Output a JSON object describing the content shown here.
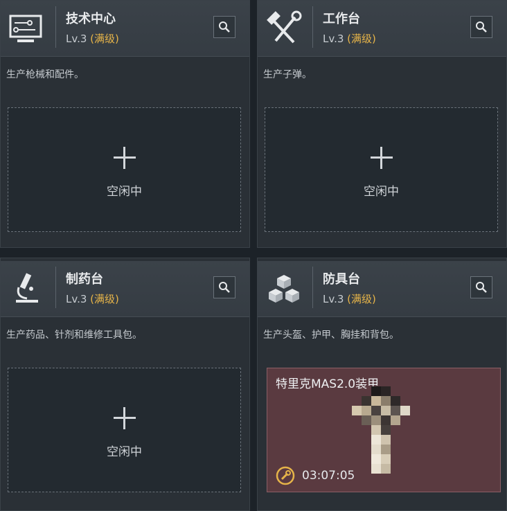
{
  "cards": [
    {
      "title": "技术中心",
      "level_prefix": "Lv.3",
      "level_status": "(满级)",
      "description": "生产枪械和配件。",
      "slot_text": "空闲中",
      "icon": "computer-terminal-icon"
    },
    {
      "title": "工作台",
      "level_prefix": "Lv.3",
      "level_status": "(满级)",
      "description": "生产子弹。",
      "slot_text": "空闲中",
      "icon": "hammer-wrench-icon"
    },
    {
      "title": "制药台",
      "level_prefix": "Lv.3",
      "level_status": "(满级)",
      "description": "生产药品、针剂和维修工具包。",
      "slot_text": "空闲中",
      "icon": "microscope-icon"
    },
    {
      "title": "防具台",
      "level_prefix": "Lv.3",
      "level_status": "(满级)",
      "description": "生产头盔、护甲、胸挂和背包。",
      "icon": "armor-cubes-icon",
      "crafting": {
        "item_name": "特里克MAS2.0装甲",
        "timer": "03:07:05"
      }
    }
  ],
  "colors": {
    "background": "#1c2228",
    "card": "#2a3036",
    "header": "#3b4249",
    "accent_gold": "#e6b449",
    "crafting_bg": "#5a3a40"
  }
}
